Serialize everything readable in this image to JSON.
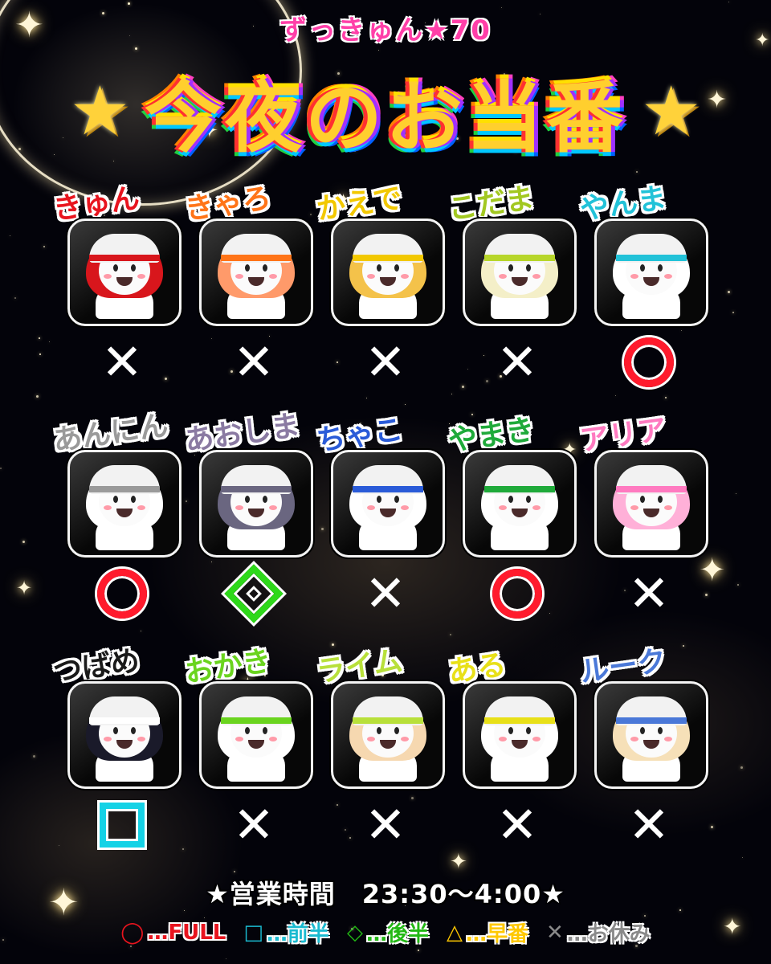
{
  "header": {
    "subtitle": "ずっきゅん★70",
    "title": "今夜のお当番",
    "title_star": "★"
  },
  "members": [
    {
      "name": "きゅん",
      "name_color": "#e8141e",
      "status": "x",
      "hair": "#d8161c",
      "band": "#d8161c"
    },
    {
      "name": "きゃろ",
      "name_color": "#ff7418",
      "status": "x",
      "hair": "#ff9a6a",
      "band": "#ff7418"
    },
    {
      "name": "かえで",
      "name_color": "#f2c800",
      "status": "x",
      "hair": "#f4c24a",
      "band": "#f2c800"
    },
    {
      "name": "こだま",
      "name_color": "#a2c820",
      "status": "x",
      "hair": "#f4efc8",
      "band": "#b7d62a"
    },
    {
      "name": "やんま",
      "name_color": "#22c2d8",
      "status": "o",
      "hair": "#ffffff",
      "band": "#22c2d8"
    },
    {
      "name": "あんにん",
      "name_color": "#9a9a9a",
      "status": "o",
      "hair": "#ffffff",
      "band": "#9a9a9a"
    },
    {
      "name": "あおしま",
      "name_color": "#8a7aa2",
      "status": "diamond",
      "hair": "#6a6680",
      "band": "#6a6680"
    },
    {
      "name": "ちゃこ",
      "name_color": "#2a5bd8",
      "status": "x",
      "hair": "#ffffff",
      "band": "#2a5bd8"
    },
    {
      "name": "やまき",
      "name_color": "#1faa3a",
      "status": "o",
      "hair": "#ffffff",
      "band": "#1faa3a"
    },
    {
      "name": "アリア",
      "name_color": "#ff7ac0",
      "status": "x",
      "hair": "#ffb0d8",
      "band": "#ff7ac0"
    },
    {
      "name": "つばめ",
      "name_color": "#1a1a1a",
      "status": "square",
      "hair": "#1a1a2a",
      "band": "#ffffff"
    },
    {
      "name": "おかき",
      "name_color": "#6ad41e",
      "status": "x",
      "hair": "#ffffff",
      "band": "#6ad41e"
    },
    {
      "name": "ライム",
      "name_color": "#b8e03a",
      "status": "x",
      "hair": "#f6d8b0",
      "band": "#b8e03a"
    },
    {
      "name": "ある",
      "name_color": "#e8e018",
      "status": "x",
      "hair": "#ffffff",
      "band": "#e8e018"
    },
    {
      "name": "ルーク",
      "name_color": "#4a78d8",
      "status": "x",
      "hair": "#f6e0b8",
      "band": "#4a78d8"
    }
  ],
  "hours": "★営業時間　23:30〜4:00★",
  "legend": [
    {
      "symbol": "◯",
      "label": "…FULL",
      "color": "#e8141e"
    },
    {
      "symbol": "□",
      "label": "…前半",
      "color": "#1abad0"
    },
    {
      "symbol": "◇",
      "label": "…後半",
      "color": "#22b814"
    },
    {
      "symbol": "△",
      "label": "…早番",
      "color": "#ffc800"
    },
    {
      "symbol": "✕",
      "label": "…お休み",
      "color": "#8a8a8a"
    }
  ]
}
